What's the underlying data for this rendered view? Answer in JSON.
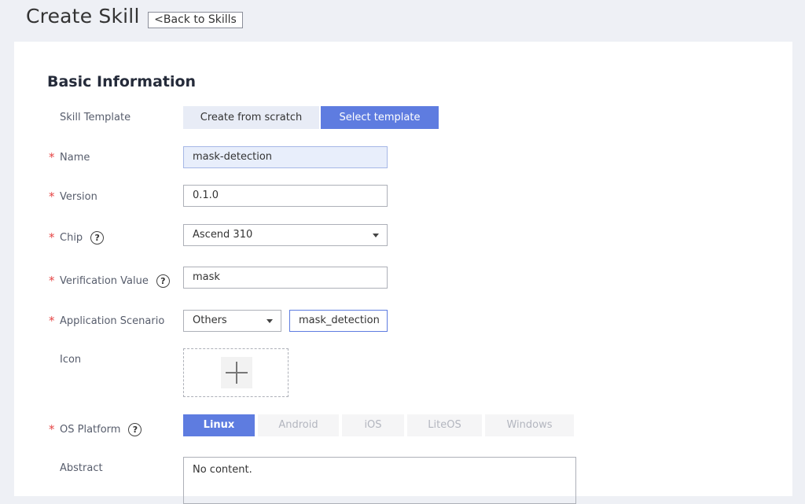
{
  "header": {
    "title": "Create Skill",
    "back_label": "<Back to Skills"
  },
  "section": {
    "title": "Basic Information"
  },
  "fields": {
    "skill_template": {
      "label": "Skill Template",
      "options": [
        "Create from scratch",
        "Select template"
      ],
      "selected": "Select template"
    },
    "name": {
      "label": "Name",
      "value": "mask-detection",
      "required": true
    },
    "version": {
      "label": "Version",
      "value": "0.1.0",
      "required": true
    },
    "chip": {
      "label": "Chip",
      "value": "Ascend 310",
      "required": true,
      "help_icon": "?"
    },
    "verification_value": {
      "label": "Verification Value",
      "value": "mask",
      "required": true,
      "help_icon": "?"
    },
    "application_scenario": {
      "label": "Application Scenario",
      "select_value": "Others",
      "custom_value": "mask_detection",
      "required": true
    },
    "icon": {
      "label": "Icon",
      "upload_icon": "plus-icon"
    },
    "os_platform": {
      "label": "OS Platform",
      "required": true,
      "help_icon": "?",
      "options": [
        "Linux",
        "Android",
        "iOS",
        "LiteOS",
        "Windows"
      ],
      "selected": "Linux"
    },
    "abstract": {
      "label": "Abstract",
      "value": "No content."
    }
  },
  "colors": {
    "accent": "#5e7ce0",
    "required": "#e54545",
    "page_bg": "#eef0f5"
  }
}
